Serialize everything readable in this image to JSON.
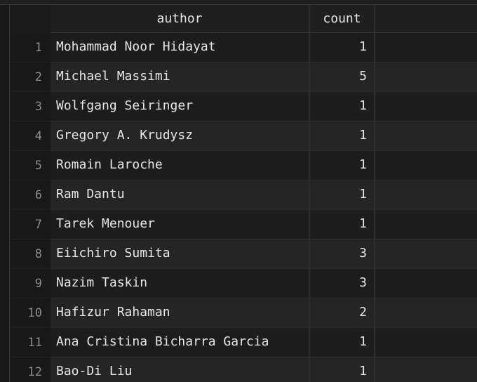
{
  "columns": {
    "author": "author",
    "count": "count"
  },
  "rows": [
    {
      "num": "1",
      "author": "Mohammad Noor Hidayat",
      "count": "1"
    },
    {
      "num": "2",
      "author": "Michael Massimi",
      "count": "5"
    },
    {
      "num": "3",
      "author": "Wolfgang Seiringer",
      "count": "1"
    },
    {
      "num": "4",
      "author": "Gregory A. Krudysz",
      "count": "1"
    },
    {
      "num": "5",
      "author": "Romain Laroche",
      "count": "1"
    },
    {
      "num": "6",
      "author": "Ram Dantu",
      "count": "1"
    },
    {
      "num": "7",
      "author": "Tarek Menouer",
      "count": "1"
    },
    {
      "num": "8",
      "author": "Eiichiro Sumita",
      "count": "3"
    },
    {
      "num": "9",
      "author": "Nazim Taskin",
      "count": "3"
    },
    {
      "num": "10",
      "author": "Hafizur Rahaman",
      "count": "2"
    },
    {
      "num": "11",
      "author": "Ana Cristina Bicharra Garcia",
      "count": "1"
    },
    {
      "num": "12",
      "author": "Bao-Di Liu",
      "count": "1"
    }
  ]
}
